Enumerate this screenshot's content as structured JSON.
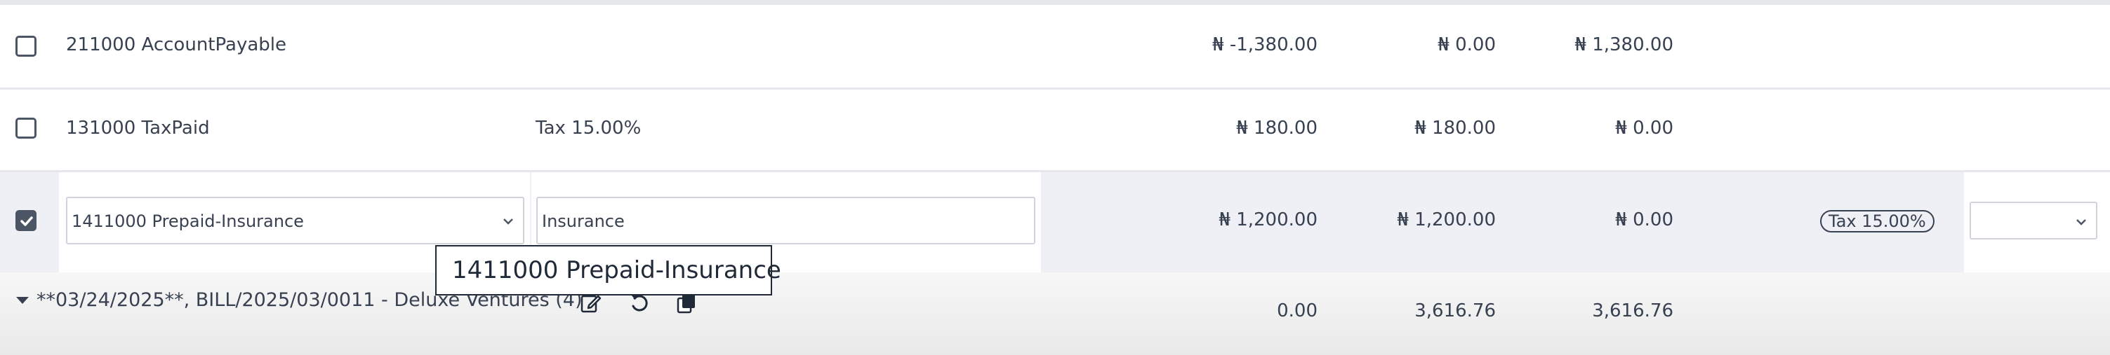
{
  "lines": [
    {
      "account": "211000 AccountPayable",
      "label": "",
      "balance": "₦ -1,380.00",
      "debit": "₦ 0.00",
      "credit": "₦ 1,380.00"
    },
    {
      "account": "131000 TaxPaid",
      "label": "Tax 15.00%",
      "balance": "₦ 180.00",
      "debit": "₦ 180.00",
      "credit": "₦ 0.00"
    },
    {
      "account": "1411000 Prepaid-Insurance",
      "label": "Insurance",
      "balance": "₦ 1,200.00",
      "debit": "₦ 1,200.00",
      "credit": "₦ 0.00",
      "tax_tag": "Tax 15.00%",
      "tax_select": ""
    }
  ],
  "tooltip": "1411000 Prepaid-Insurance",
  "group": {
    "label": "**03/24/2025**, BILL/2025/03/0011 - Deluxe Ventures (4)",
    "balance": "0.00",
    "debit": "3,616.76",
    "credit": "3,616.76"
  },
  "icons": {
    "edit": "edit-icon",
    "undo": "undo-icon",
    "copy": "copy-icon",
    "caret": "caret-down-icon"
  }
}
